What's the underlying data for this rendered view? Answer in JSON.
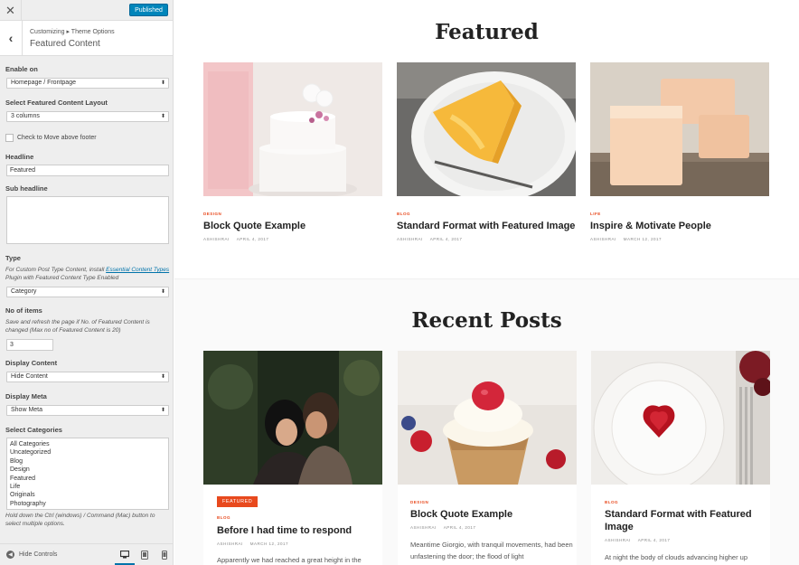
{
  "sidebar": {
    "close_icon": "close-icon",
    "publish_label": "Published",
    "breadcrumb": "Customizing ▸ Theme Options",
    "section_title": "Featured Content",
    "enable_on": {
      "label": "Enable on",
      "value": "Homepage / Frontpage"
    },
    "layout": {
      "label": "Select Featured Content Layout",
      "value": "3 columns"
    },
    "move_footer": {
      "label": "Check to Move above footer",
      "checked": false
    },
    "headline": {
      "label": "Headline",
      "value": "Featured"
    },
    "sub_headline": {
      "label": "Sub headline",
      "value": ""
    },
    "type": {
      "label": "Type",
      "desc_before": "For Custom Post Type Content, install ",
      "desc_link": "Essential Content Types",
      "desc_after": " Plugin with Featured Content Type Enabled",
      "value": "Category"
    },
    "items": {
      "label": "No of items",
      "desc": "Save and refresh the page if No. of Featured Content is changed (Max no of Featured Content is 20)",
      "value": "3"
    },
    "display_content": {
      "label": "Display Content",
      "value": "Hide Content"
    },
    "display_meta": {
      "label": "Display Meta",
      "value": "Show Meta"
    },
    "categories": {
      "label": "Select Categories",
      "options": [
        "All Categories",
        "Uncategorized",
        "Blog",
        "Design",
        "Featured",
        "Life",
        "Originals",
        "Photography"
      ],
      "hint": "Hold down the Ctrl (windows) / Command (Mac) button to select multiple options."
    },
    "footer": {
      "hide_controls": "Hide Controls",
      "active_device": "desktop"
    }
  },
  "preview": {
    "featured": {
      "title": "Featured",
      "cards": [
        {
          "category": "DESIGN",
          "title": "Block Quote Example",
          "author": "ASHISHRAI",
          "date": "APRIL 4, 2017"
        },
        {
          "category": "BLOG",
          "title": "Standard Format with Featured Image",
          "author": "ASHISHRAI",
          "date": "APRIL 4, 2017"
        },
        {
          "category": "LIFE",
          "title": "Inspire & Motivate People",
          "author": "ASHISHRAI",
          "date": "MARCH 12, 2017"
        }
      ]
    },
    "recent": {
      "title": "Recent Posts",
      "cards": [
        {
          "badge": "FEATURED",
          "category": "BLOG",
          "title": "Before I had time to respond",
          "author": "ASHISHRAI",
          "date": "MARCH 12, 2017",
          "excerpt": "Apparently we had reached a great height in the"
        },
        {
          "category": "DESIGN",
          "title": "Block Quote Example",
          "author": "ASHISHRAI",
          "date": "APRIL 4, 2017",
          "excerpt": "Meantime Giorgio, with tranquil movements, had been unfastening the door; the flood of light"
        },
        {
          "category": "BLOG",
          "title": "Standard Format with Featured Image",
          "author": "ASHISHRAI",
          "date": "APRIL 4, 2017",
          "excerpt": "At night the body of clouds advancing higher up"
        }
      ]
    }
  },
  "colors": {
    "accent": "#e8491d",
    "publish": "#0085ba",
    "link": "#0073aa"
  }
}
